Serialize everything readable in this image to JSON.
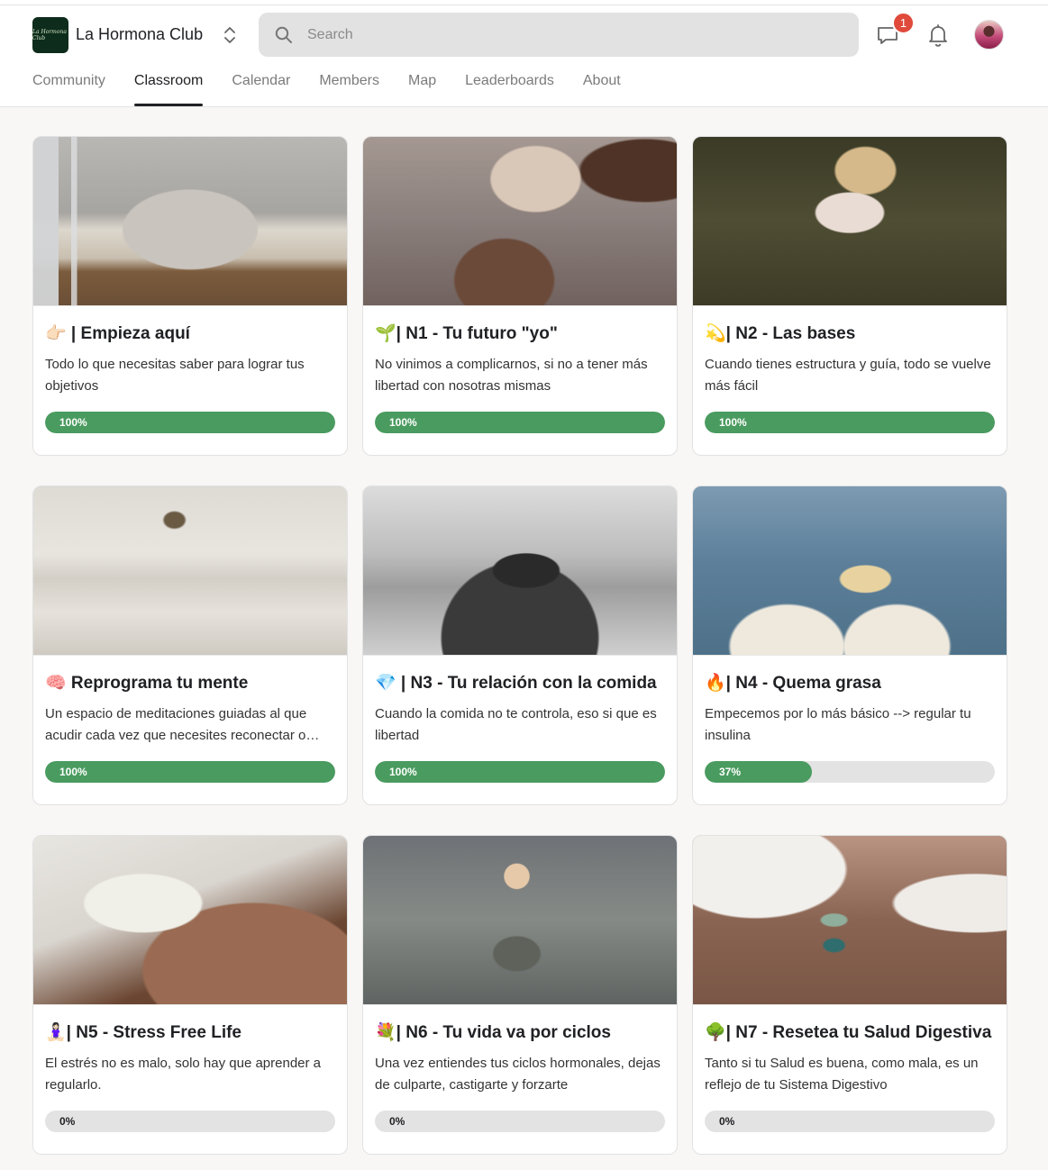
{
  "app": {
    "club_name": "La Hormona Club",
    "logo_text": "La Hormona Club"
  },
  "search": {
    "placeholder": "Search"
  },
  "notifications": {
    "chat_badge": "1"
  },
  "nav": {
    "tabs": [
      {
        "label": "Community",
        "active": false
      },
      {
        "label": "Classroom",
        "active": true
      },
      {
        "label": "Calendar",
        "active": false
      },
      {
        "label": "Members",
        "active": false
      },
      {
        "label": "Map",
        "active": false
      },
      {
        "label": "Leaderboards",
        "active": false
      },
      {
        "label": "About",
        "active": false
      }
    ]
  },
  "colors": {
    "progress": "#4a9b5f",
    "track": "#e3e3e3",
    "badge": "#e04a3b",
    "logo_bg": "#0e2c1b"
  },
  "courses": [
    {
      "title": "👉🏻 | Empieza aquí",
      "description": "Todo lo que necesitas saber para lograr tus objetivos",
      "progress": 100,
      "progress_label": "100%",
      "image": "woman-reading-on-sofa"
    },
    {
      "title": "🌱| N1 - Tu futuro \"yo\"",
      "description": "No vinimos a complicarnos, si no a tener más libertad con nosotras mismas",
      "progress": 100,
      "progress_label": "100%",
      "image": "hands-pouring-from-shell"
    },
    {
      "title": "💫| N2 - Las bases",
      "description": "Cuando tienes estructura y guía, todo se vuelve más fácil",
      "progress": 100,
      "progress_label": "100%",
      "image": "woman-holding-flowers-in-field"
    },
    {
      "title": "🧠 Reprograma tu mente",
      "description": "Un espacio de meditaciones guiadas al que acudir cada vez que necesites reconectar o…",
      "progress": 100,
      "progress_label": "100%",
      "image": "meditation-room"
    },
    {
      "title": "💎 | N3 - Tu relación con la comida",
      "description": "Cuando la comida no te controla, eso si que es libertad",
      "progress": 100,
      "progress_label": "100%",
      "image": "double-exposure-woman-silhouette"
    },
    {
      "title": "🔥| N4 - Quema grasa",
      "description": "Empecemos por lo más básico --> regular tu insulina",
      "progress": 37,
      "progress_label": "37%",
      "image": "pasta-by-the-sea"
    },
    {
      "title": "🧘🏻‍♀️| N5 - Stress Free Life",
      "description": "El estrés no es malo, solo hay que aprender a regularlo.",
      "progress": 0,
      "progress_label": "0%",
      "image": "white-flowers-on-shoulder"
    },
    {
      "title": "💐| N6 - Tu vida va por ciclos",
      "description": "Una vez entiendes tus ciclos hormonales, dejas de culparte, castigarte y forzarte",
      "progress": 0,
      "progress_label": "0%",
      "image": "silhouette-holding-moon"
    },
    {
      "title": "🌳| N7 - Resetea tu Salud Digestiva",
      "description": "Tanto si tu Salud es buena, como mala, es un reflejo de tu Sistema Digestivo",
      "progress": 0,
      "progress_label": "0%",
      "image": "crystals-on-belly"
    }
  ]
}
